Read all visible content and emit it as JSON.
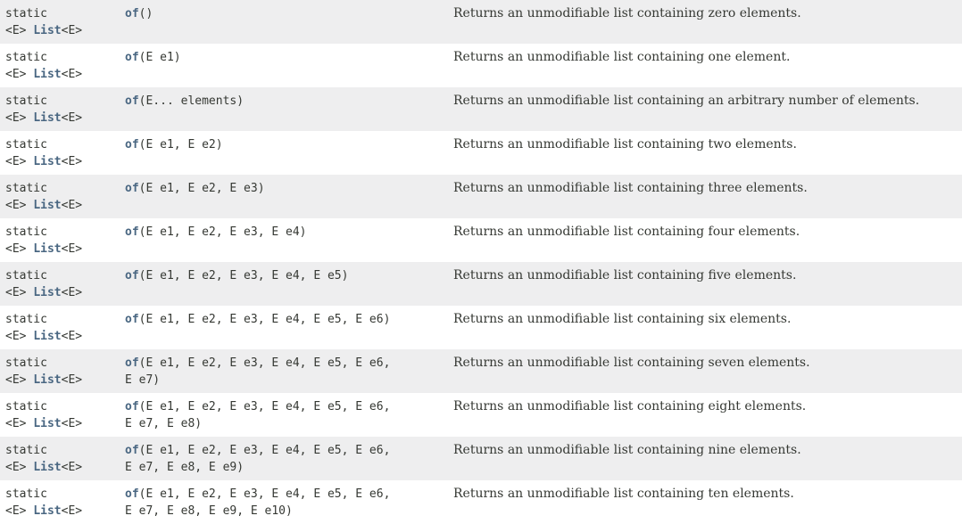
{
  "rows": [
    {
      "modifier": "static",
      "type_params": "<E> ",
      "return_type": "List",
      "return_generic": "<E>",
      "method": "of",
      "params_line1": "()",
      "params_line2": "",
      "description": "Returns an unmodifiable list containing zero elements."
    },
    {
      "modifier": "static",
      "type_params": "<E> ",
      "return_type": "List",
      "return_generic": "<E>",
      "method": "of",
      "params_line1": "(E e1)",
      "params_line2": "",
      "description": "Returns an unmodifiable list containing one element."
    },
    {
      "modifier": "static",
      "type_params": "<E> ",
      "return_type": "List",
      "return_generic": "<E>",
      "method": "of",
      "params_line1": "(E... elements)",
      "params_line2": "",
      "description": "Returns an unmodifiable list containing an arbitrary number of elements."
    },
    {
      "modifier": "static",
      "type_params": "<E> ",
      "return_type": "List",
      "return_generic": "<E>",
      "method": "of",
      "params_line1": "(E e1, E e2)",
      "params_line2": "",
      "description": "Returns an unmodifiable list containing two elements."
    },
    {
      "modifier": "static",
      "type_params": "<E> ",
      "return_type": "List",
      "return_generic": "<E>",
      "method": "of",
      "params_line1": "(E e1, E e2, E e3)",
      "params_line2": "",
      "description": "Returns an unmodifiable list containing three elements."
    },
    {
      "modifier": "static",
      "type_params": "<E> ",
      "return_type": "List",
      "return_generic": "<E>",
      "method": "of",
      "params_line1": "(E e1, E e2, E e3, E e4)",
      "params_line2": "",
      "description": "Returns an unmodifiable list containing four elements."
    },
    {
      "modifier": "static",
      "type_params": "<E> ",
      "return_type": "List",
      "return_generic": "<E>",
      "method": "of",
      "params_line1": "(E e1, E e2, E e3, E e4, E e5)",
      "params_line2": "",
      "description": "Returns an unmodifiable list containing five elements."
    },
    {
      "modifier": "static",
      "type_params": "<E> ",
      "return_type": "List",
      "return_generic": "<E>",
      "method": "of",
      "params_line1": "(E e1, E e2, E e3, E e4, E e5, E e6)",
      "params_line2": "",
      "description": "Returns an unmodifiable list containing six elements."
    },
    {
      "modifier": "static",
      "type_params": "<E> ",
      "return_type": "List",
      "return_generic": "<E>",
      "method": "of",
      "params_line1": "(E e1, E e2, E e3, E e4, E e5, E e6,",
      "params_line2": "E e7)",
      "description": "Returns an unmodifiable list containing seven elements."
    },
    {
      "modifier": "static",
      "type_params": "<E> ",
      "return_type": "List",
      "return_generic": "<E>",
      "method": "of",
      "params_line1": "(E e1, E e2, E e3, E e4, E e5, E e6,",
      "params_line2": "E e7, E e8)",
      "description": "Returns an unmodifiable list containing eight elements."
    },
    {
      "modifier": "static",
      "type_params": "<E> ",
      "return_type": "List",
      "return_generic": "<E>",
      "method": "of",
      "params_line1": "(E e1, E e2, E e3, E e4, E e5, E e6,",
      "params_line2": "E e7, E e8, E e9)",
      "description": "Returns an unmodifiable list containing nine elements."
    },
    {
      "modifier": "static",
      "type_params": "<E> ",
      "return_type": "List",
      "return_generic": "<E>",
      "method": "of",
      "params_line1": "(E e1, E e2, E e3, E e4, E e5, E e6,",
      "params_line2": "E e7, E e8, E e9, E e10)",
      "description": "Returns an unmodifiable list containing ten elements."
    }
  ],
  "colors": {
    "link": "#4a6782",
    "alt_row": "#eeeeef",
    "text": "#353833"
  }
}
